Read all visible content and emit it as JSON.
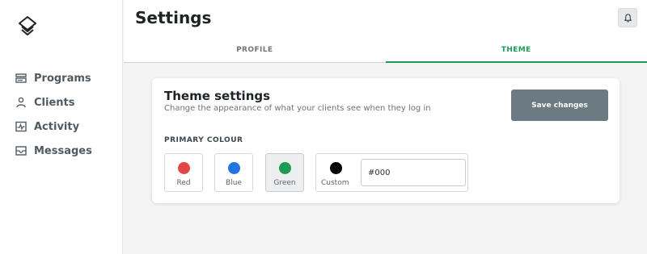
{
  "sidebar": {
    "logo_icon": "stacked-layers-logo-icon",
    "items": [
      {
        "label": "Programs",
        "icon": "programs-icon"
      },
      {
        "label": "Clients",
        "icon": "clients-icon"
      },
      {
        "label": "Activity",
        "icon": "activity-icon"
      },
      {
        "label": "Messages",
        "icon": "messages-icon"
      }
    ]
  },
  "header": {
    "title": "Settings",
    "bell_icon": "bell-icon"
  },
  "tabs": [
    {
      "label": "PROFILE",
      "active": false
    },
    {
      "label": "THEME",
      "active": true
    }
  ],
  "theme_card": {
    "title": "Theme settings",
    "subtitle": "Change the appearance of what your clients see when they log in",
    "save_label": "Save changes",
    "section_label": "PRIMARY COLOUR",
    "swatches": [
      {
        "label": "Red",
        "color": "#e04848",
        "selected": false
      },
      {
        "label": "Blue",
        "color": "#2575e0",
        "selected": false
      },
      {
        "label": "Green",
        "color": "#1e9c56",
        "selected": true
      }
    ],
    "custom": {
      "label": "Custom",
      "color": "#000000",
      "value": "#000"
    }
  },
  "colors": {
    "accent": "#1e9c56",
    "save_button": "#6c7a82",
    "sidebar_text": "#4f5a62"
  }
}
